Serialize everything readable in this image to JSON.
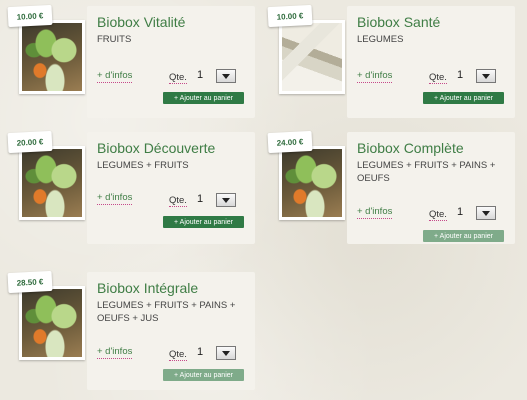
{
  "qte_label": "Qte.",
  "add_label": "+ Ajouter au panier",
  "infos_label": "+ d'infos",
  "products": [
    {
      "price": "10.00 €",
      "name": "Biobox Vitalité",
      "desc": "FRUITS",
      "qty": "1"
    },
    {
      "price": "10.00 €",
      "name": "Biobox Santé",
      "desc": "LEGUMES",
      "qty": "1"
    },
    {
      "price": "20.00 €",
      "name": "Biobox Découverte",
      "desc": "LEGUMES + FRUITS",
      "qty": "1"
    },
    {
      "price": "24.00 €",
      "name": "Biobox Complète",
      "desc": "LEGUMES + FRUITS + PAINS + OEUFS",
      "qty": "1"
    },
    {
      "price": "28.50 €",
      "name": "Biobox Intégrale",
      "desc": "LEGUMES + FRUITS + PAINS + OEUFS + JUS",
      "qty": "1"
    }
  ]
}
